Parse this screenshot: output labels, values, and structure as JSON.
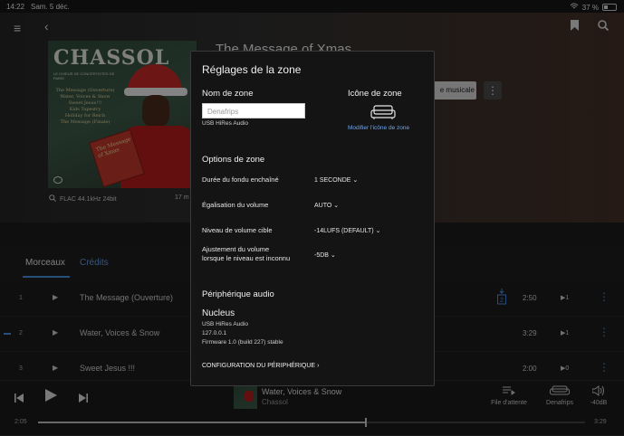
{
  "status": {
    "time": "14:22",
    "date": "Sam. 5 déc.",
    "battery": "37 %"
  },
  "hero": {
    "album_title": "The Message of Xmas",
    "art_title": "CHASSOL",
    "art_subtitle": "LE CHŒUR DE CONCERTISTES DE PARIS",
    "art_tracks": [
      "The Message (Ouverture)",
      "Water, Voices & Snow",
      "Sweet Jesus!!!",
      "Kids Tapestry",
      "Holiday for Reich",
      "The Message (Finale)"
    ],
    "book_text": "The Message of Xmas",
    "format": "FLAC 44.1kHz 24bit",
    "duration": "17 m",
    "pill_label": "e musicale"
  },
  "tabs": [
    {
      "label": "Morceaux"
    },
    {
      "label": "Crédits"
    }
  ],
  "tracks": [
    {
      "num": "1",
      "name": "The Message (Ouverture)",
      "time": "2:50",
      "plays": "1",
      "download": "2"
    },
    {
      "num": "2",
      "name": "Water, Voices & Snow",
      "time": "3:29",
      "plays": "1"
    },
    {
      "num": "3",
      "name": "Sweet Jesus !!!",
      "time": "2:00",
      "plays": "0"
    }
  ],
  "now_playing": {
    "title": "Water, Voices & Snow",
    "artist": "Chassol",
    "elapsed": "2:05",
    "total": "3:29",
    "progress": 0.6,
    "queue_label": "File d'attente",
    "zone_label": "Denafrips",
    "volume_label": "-40dB"
  },
  "dialog": {
    "title": "Réglages de la zone",
    "zone_name_heading": "Nom de zone",
    "zone_name_placeholder": "Denafrips",
    "zone_name_caption": "USB HiRes Audio",
    "zone_icon_heading": "Icône de zone",
    "zone_icon_link": "Modifier l'icône de zone",
    "options_heading": "Options de zone",
    "options": [
      {
        "label": "Durée du fondu enchaîné",
        "value": "1 SECONDE"
      },
      {
        "label": "Égalisation du volume",
        "value": "AUTO"
      },
      {
        "label": "Niveau de volume cible",
        "value": "-14LUFS (DEFAULT)"
      },
      {
        "label": "Ajustement du volume",
        "label2": "lorsque le niveau est inconnu",
        "value": "-5DB"
      }
    ],
    "device_heading": "Périphérique audio",
    "device": {
      "name": "Nucleus",
      "lines": [
        "USB HiRes Audio",
        "127.0.0.1",
        "Firmware 1.0 (build 227) stable"
      ]
    },
    "config_label": "CONFIGURATION DU PÉRIPHÉRIQUE"
  },
  "colors": {
    "accent": "#4a90e2",
    "dialog_bg": "#141414",
    "link": "#6aa7f0"
  }
}
